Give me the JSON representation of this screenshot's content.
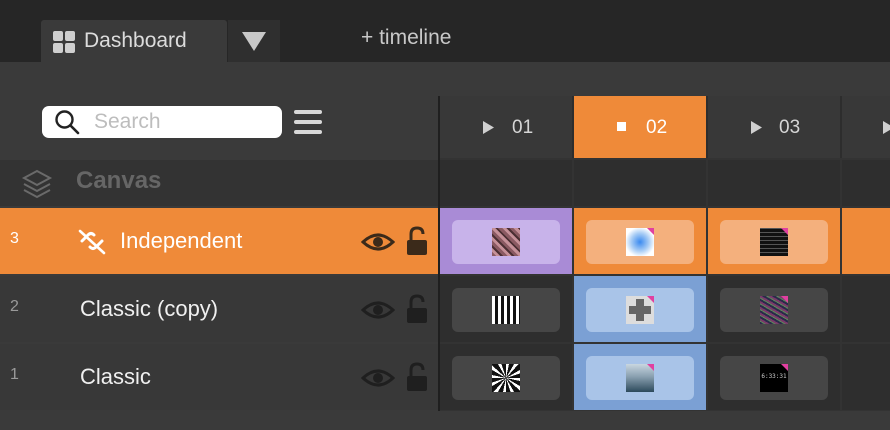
{
  "tabs": {
    "dashboard_label": "Dashboard",
    "add_timeline_label": "+ timeline"
  },
  "search": {
    "placeholder": "Search"
  },
  "columns": [
    {
      "label": "01",
      "state": "play"
    },
    {
      "label": "02",
      "state": "stop",
      "active": true
    },
    {
      "label": "03",
      "state": "play"
    }
  ],
  "canvas": {
    "label": "Canvas"
  },
  "layers": [
    {
      "number": "3",
      "name": "Independent",
      "active": true
    },
    {
      "number": "2",
      "name": "Classic (copy)"
    },
    {
      "number": "1",
      "name": "Classic"
    }
  ],
  "thumbnail_text": "6:33:31",
  "colors": {
    "accent_orange": "#EF8A39",
    "purple_clip": "#A98BD6",
    "blue_clip": "#A9C4E8",
    "marker_pink": "#E040A0"
  },
  "icons": {
    "dashboard": "grid-icon",
    "dropdown": "caret-down-icon",
    "search": "search-icon",
    "menu": "hamburger-icon",
    "canvas": "layers-icon",
    "independent": "unlink-icon",
    "visibility": "eye-icon",
    "lock": "unlocked-padlock-icon"
  }
}
